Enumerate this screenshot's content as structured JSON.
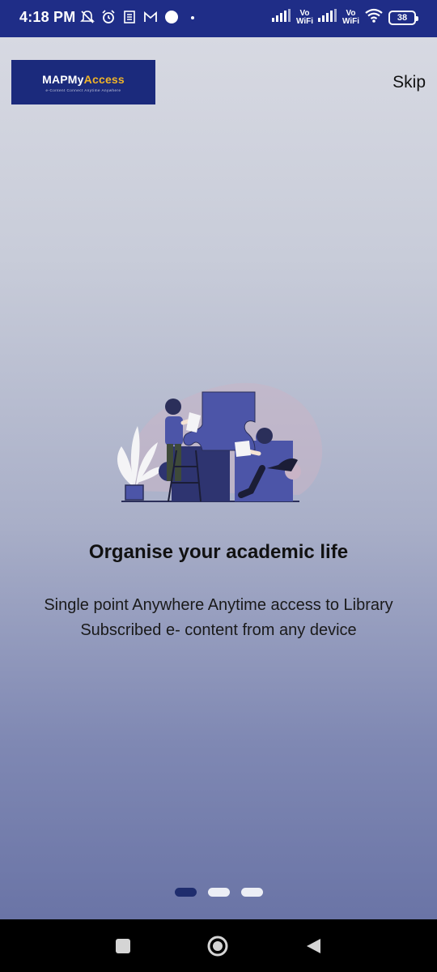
{
  "status_bar": {
    "time": "4:18 PM",
    "vo_top": "Vo",
    "wifi_label": "WiFi",
    "battery": "38"
  },
  "brand": {
    "logo_main": "MAPMy",
    "logo_accent": "Access",
    "logo_tagline": "e-Content Connect Anytime Anywhere"
  },
  "onboarding": {
    "skip_label": "Skip",
    "title": "Organise your academic life",
    "description": "Single point Anywhere Anytime access to Library Subscribed e- content from any device",
    "pages": 3,
    "current_page": 1
  },
  "colors": {
    "status_bar": "#1f2d87",
    "logo_bg": "#1b2a7c",
    "logo_accent": "#f0b429",
    "puzzle": "#4c55a8",
    "dot_active": "#1f2d6e",
    "dot_inactive": "#eceef5"
  },
  "icons": {
    "nav": [
      "recents-square-icon",
      "home-circle-icon",
      "back-triangle-icon"
    ]
  }
}
